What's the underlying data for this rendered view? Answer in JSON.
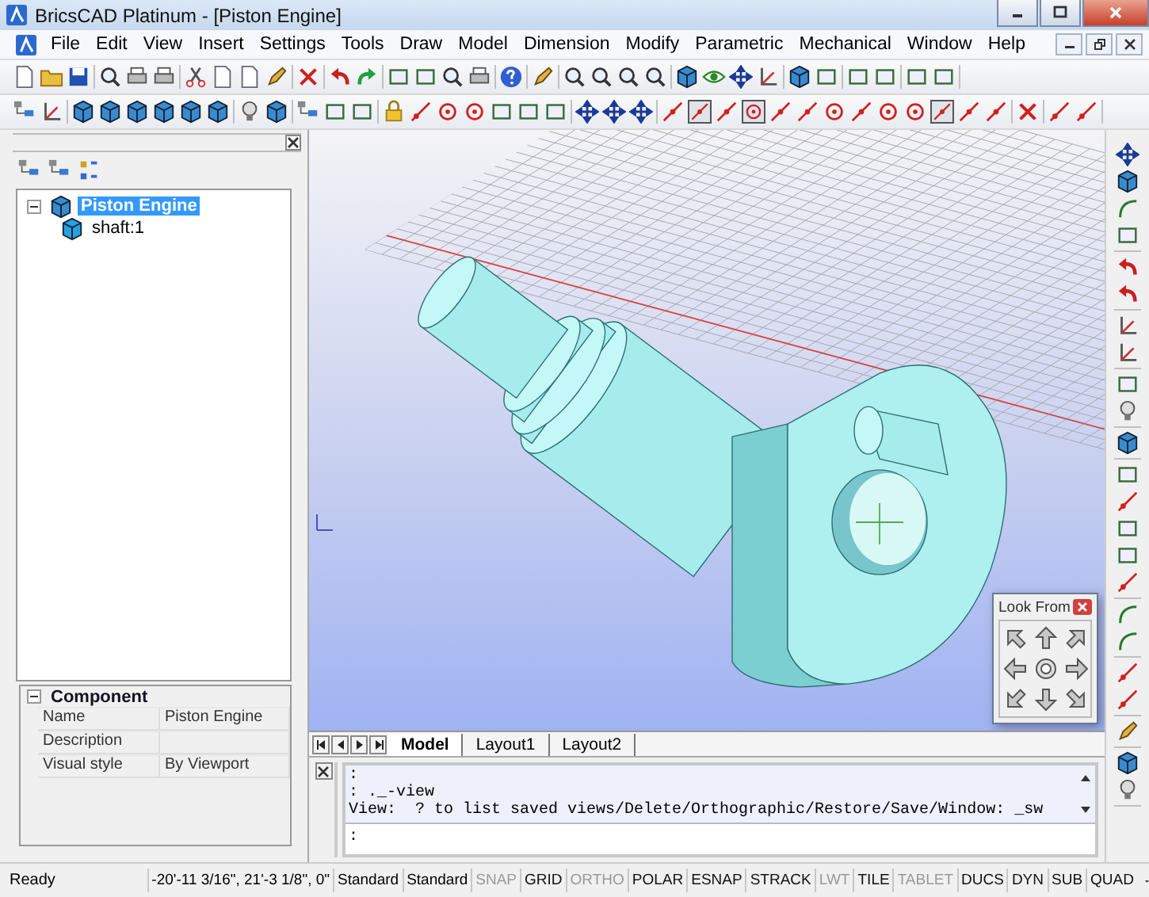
{
  "window": {
    "title": "BricsCAD Platinum - [Piston Engine]"
  },
  "menu": [
    "File",
    "Edit",
    "View",
    "Insert",
    "Settings",
    "Tools",
    "Draw",
    "Model",
    "Dimension",
    "Modify",
    "Parametric",
    "Mechanical",
    "Window",
    "Help"
  ],
  "snap_buttons": [
    {
      "pressed": false
    },
    {
      "pressed": true
    },
    {
      "pressed": false
    },
    {
      "pressed": true
    },
    {
      "pressed": false
    },
    {
      "pressed": false
    },
    {
      "pressed": false
    },
    {
      "pressed": false
    },
    {
      "pressed": false
    },
    {
      "pressed": false
    },
    {
      "pressed": true
    },
    {
      "pressed": false
    },
    {
      "pressed": false
    }
  ],
  "tree": {
    "items": [
      {
        "label": "Piston Engine",
        "selected": true,
        "expanded": true,
        "children": [
          {
            "label": "shaft:1",
            "selected": false
          }
        ]
      }
    ]
  },
  "properties": {
    "section": "Component",
    "expanded": true,
    "rows": [
      {
        "name": "Name",
        "value": "Piston Engine"
      },
      {
        "name": "Description"
      },
      {
        "name": "Visual style",
        "value": "By Viewport"
      }
    ]
  },
  "look_from": {
    "title": "Look From"
  },
  "layout_tabs": [
    {
      "label": "Model",
      "selected": true
    },
    {
      "label": "Layout1",
      "selected": false
    },
    {
      "label": "Layout2",
      "selected": false
    }
  ],
  "command_history": [
    ":",
    ": ._-view",
    "View:  ? to list saved views/Delete/Orthographic/Restore/Save/Window: _sw"
  ],
  "command_prompt": ":",
  "status_bar": {
    "message": "Ready",
    "coordinates": "-20'-11 3/16\", 21'-3 1/8\", 0\"",
    "text_style": "Standard",
    "dim_style": "Standard",
    "toggles": [
      {
        "label": "SNAP",
        "on": false
      },
      {
        "label": "GRID",
        "on": true
      },
      {
        "label": "ORTHO",
        "on": false
      },
      {
        "label": "POLAR",
        "on": true
      },
      {
        "label": "ESNAP",
        "on": true
      },
      {
        "label": "STRACK",
        "on": true
      },
      {
        "label": "LWT",
        "on": false
      },
      {
        "label": "TILE",
        "on": true
      },
      {
        "label": "TABLET",
        "on": false
      },
      {
        "label": "DUCS",
        "on": true
      },
      {
        "label": "DYN",
        "on": true
      },
      {
        "label": "SUB",
        "on": true
      },
      {
        "label": "QUAD",
        "on": true
      }
    ]
  }
}
